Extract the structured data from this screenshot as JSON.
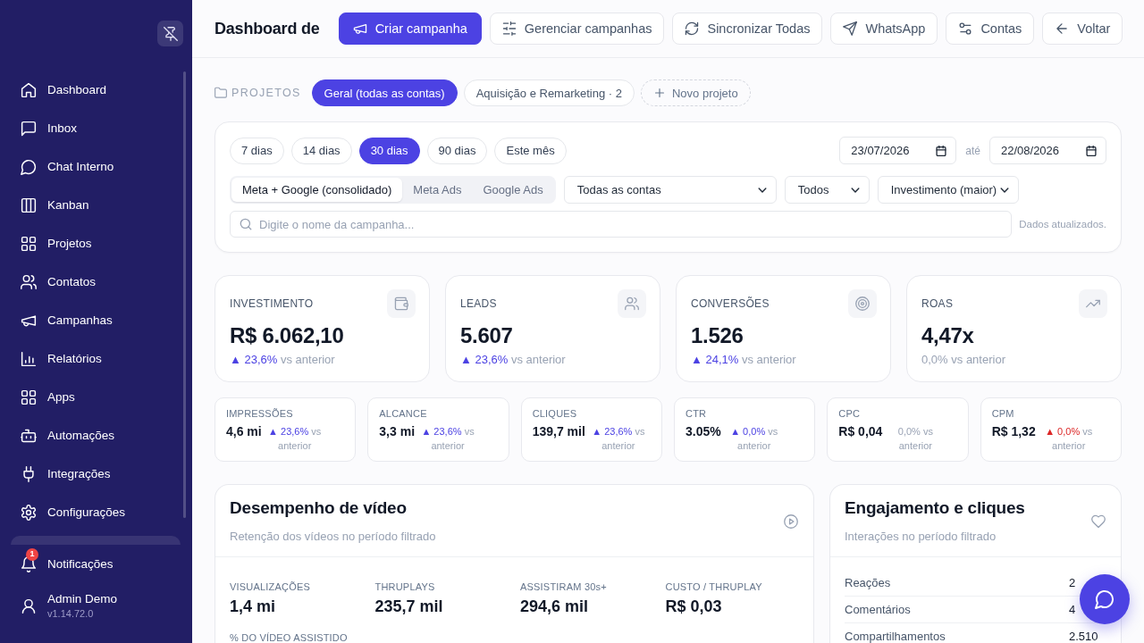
{
  "sidebar": {
    "items": [
      {
        "label": "Dashboard",
        "selected": false
      },
      {
        "label": "Inbox",
        "selected": false
      },
      {
        "label": "Chat Interno",
        "selected": false
      },
      {
        "label": "Kanban",
        "selected": false
      },
      {
        "label": "Projetos",
        "selected": false
      },
      {
        "label": "Contatos",
        "selected": false
      },
      {
        "label": "Campanhas",
        "selected": false
      },
      {
        "label": "Relatórios",
        "selected": false
      },
      {
        "label": "Apps",
        "selected": false
      },
      {
        "label": "Automações",
        "selected": false
      },
      {
        "label": "Integrações",
        "selected": false
      },
      {
        "label": "Configurações",
        "selected": false
      }
    ],
    "notifications": {
      "label": "Notificações",
      "badge": "1"
    },
    "user": {
      "name": "Admin Demo",
      "version": "v1.14.72.0"
    }
  },
  "header": {
    "title": "Dashboard de",
    "buttons": [
      {
        "label": "Criar campanha",
        "kind": "primary"
      },
      {
        "label": "Gerenciar campanhas",
        "kind": "secondary"
      },
      {
        "label": "Sincronizar Todas",
        "kind": "secondary"
      },
      {
        "label": "WhatsApp",
        "kind": "secondary"
      },
      {
        "label": "Contas",
        "kind": "secondary"
      },
      {
        "label": "Voltar",
        "kind": "secondary"
      }
    ]
  },
  "projects": {
    "label": "PROJETOS",
    "items": [
      {
        "label": "Geral (todas as contas)",
        "selected": true
      },
      {
        "label": "Aquisição e Remarketing · 2",
        "selected": false
      }
    ],
    "add_button": "Novo projeto"
  },
  "filters": {
    "periods": [
      {
        "label": "7 dias",
        "selected": false
      },
      {
        "label": "14 dias",
        "selected": false
      },
      {
        "label": "30 dias",
        "selected": true
      },
      {
        "label": "90 dias",
        "selected": false
      },
      {
        "label": "Este mês",
        "selected": false
      }
    ],
    "date_from": "23/07/2026",
    "date_separator": "até",
    "date_to": "22/08/2026",
    "sources": [
      {
        "label": "Meta + Google (consolidado)",
        "selected": true
      },
      {
        "label": "Meta Ads",
        "selected": false
      },
      {
        "label": "Google Ads",
        "selected": false
      }
    ],
    "dropdowns": [
      "Todas as contas",
      "Todos",
      "Investimento (maior)"
    ],
    "search": {
      "placeholder": "Digite o nome da campanha..."
    },
    "status": "Dados atualizados."
  },
  "kpis": [
    {
      "label": "INVESTIMENTO",
      "value": "R$ 6.062,10",
      "change": "▲ 23,6%",
      "comparison": "vs anterior",
      "color": "#4c42e3"
    },
    {
      "label": "LEADS",
      "value": "5.607",
      "change": "▲ 23,6%",
      "comparison": "vs anterior",
      "color": "#4c42e3"
    },
    {
      "label": "CONVERSÕES",
      "value": "1.526",
      "change": "▲ 24,1%",
      "comparison": "vs anterior",
      "color": "#4c42e3"
    },
    {
      "label": "ROAS",
      "value": "4,47x",
      "change": "0,0%",
      "comparison": "vs anterior",
      "color": "#9aa3b5"
    }
  ],
  "metrics": [
    {
      "label": "IMPRESSÕES",
      "value": "4,6 mi",
      "change": "▲ 23,6%",
      "comparison": "vs anterior",
      "color": "#4c42e3"
    },
    {
      "label": "ALCANCE",
      "value": "3,3 mi",
      "change": "▲ 23,6%",
      "comparison": "vs anterior",
      "color": "#4c42e3"
    },
    {
      "label": "CLIQUES",
      "value": "139,7 mil",
      "change": "▲ 23,6%",
      "comparison": "vs anterior",
      "color": "#4c42e3"
    },
    {
      "label": "CTR",
      "value": "3.05%",
      "change": "▲ 0,0%",
      "comparison": "vs anterior",
      "color": "#4c42e3"
    },
    {
      "label": "CPC",
      "value": "R$ 0,04",
      "change": "0,0%",
      "comparison": "vs anterior",
      "color": "#9aa3b5"
    },
    {
      "label": "CPM",
      "value": "R$ 1,32",
      "change": "▲ 0,0%",
      "comparison": "vs anterior",
      "color": "#dc2626"
    }
  ],
  "video": {
    "title": "Desempenho de vídeo",
    "subtitle": "Retenção dos vídeos no período filtrado",
    "stats": [
      {
        "label": "VISUALIZAÇÕES",
        "value": "1,4 mi"
      },
      {
        "label": "THRUPLAYS",
        "value": "235,7 mil"
      },
      {
        "label": "ASSISTIRAM 30s+",
        "value": "294,6 mil"
      },
      {
        "label": "CUSTO / THRUPLAY",
        "value": "R$ 0,03"
      }
    ],
    "section_label": "% DO VÍDEO ASSISTIDO"
  },
  "engagement": {
    "title": "Engajamento e cliques",
    "subtitle": "Interações no período filtrado",
    "rows": [
      {
        "label": "Reações",
        "value": "2"
      },
      {
        "label": "Comentários",
        "value": "4"
      },
      {
        "label": "Compartilhamentos",
        "value": "2.510"
      }
    ]
  }
}
